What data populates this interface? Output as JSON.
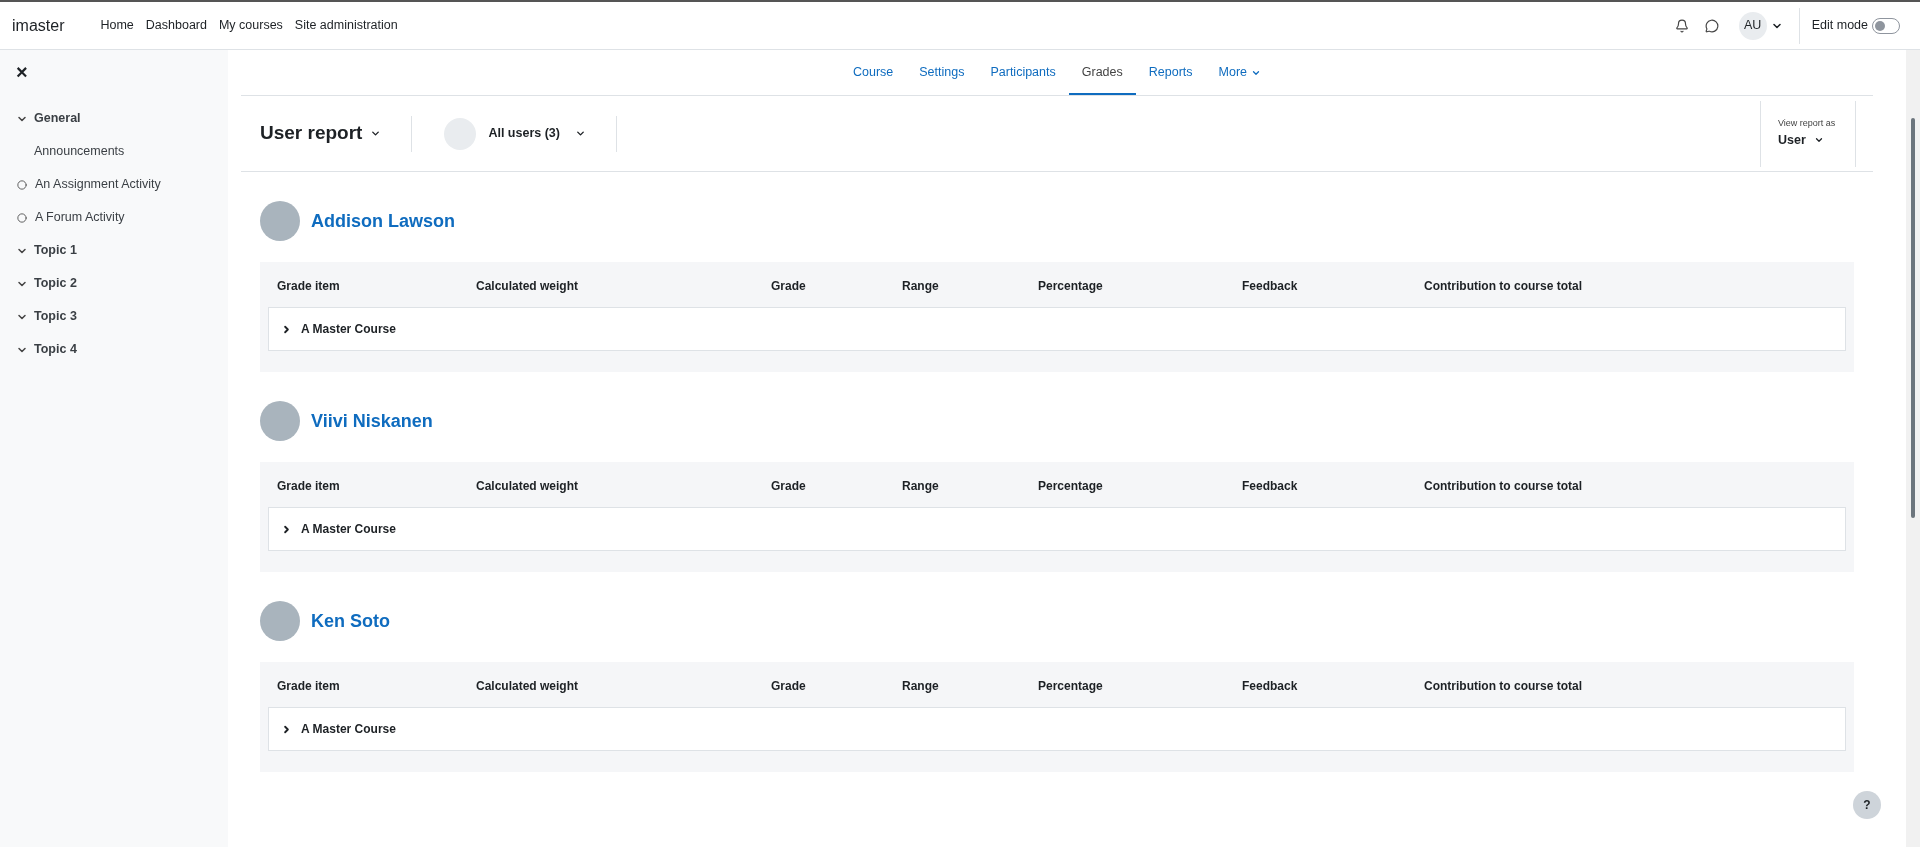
{
  "navbar": {
    "brand": "imaster",
    "links": [
      "Home",
      "Dashboard",
      "My courses",
      "Site administration"
    ],
    "user_initials": "AU",
    "edit_mode": {
      "label": "Edit mode",
      "on": false
    }
  },
  "sidebar": {
    "close": "×",
    "items": [
      {
        "kind": "section",
        "label": "General",
        "expanded": true
      },
      {
        "kind": "page",
        "label": "Announcements"
      },
      {
        "kind": "activity",
        "label": "An Assignment Activity"
      },
      {
        "kind": "activity",
        "label": "A Forum Activity"
      },
      {
        "kind": "section",
        "label": "Topic 1",
        "expanded": true
      },
      {
        "kind": "section",
        "label": "Topic 2",
        "expanded": true
      },
      {
        "kind": "section",
        "label": "Topic 3",
        "expanded": true
      },
      {
        "kind": "section",
        "label": "Topic 4",
        "expanded": true
      }
    ]
  },
  "tabs": [
    {
      "label": "Course",
      "selected": false
    },
    {
      "label": "Settings",
      "selected": false
    },
    {
      "label": "Participants",
      "selected": false
    },
    {
      "label": "Grades",
      "selected": true
    },
    {
      "label": "Reports",
      "selected": false
    },
    {
      "label": "More",
      "selected": false
    }
  ],
  "report_header": {
    "title": "User report",
    "user_filter": "All users (3)",
    "view_as_label": "View report as",
    "view_as": "User"
  },
  "users": [
    {
      "name": "Addison Lawson",
      "columns": [
        "Grade item",
        "Calculated weight",
        "Grade",
        "Range",
        "Percentage",
        "Feedback",
        "Contribution to course total"
      ],
      "rows": [
        {
          "label": "A Master Course",
          "expanded": false
        }
      ]
    },
    {
      "name": "Viivi Niskanen",
      "columns": [
        "Grade item",
        "Calculated weight",
        "Grade",
        "Range",
        "Percentage",
        "Feedback",
        "Contribution to course total"
      ],
      "rows": [
        {
          "label": "A Master Course",
          "expanded": false
        }
      ]
    },
    {
      "name": "Ken Soto",
      "columns": [
        "Grade item",
        "Calculated weight",
        "Grade",
        "Range",
        "Percentage",
        "Feedback",
        "Contribution to course total"
      ],
      "rows": [
        {
          "label": "A Master Course",
          "expanded": false
        }
      ]
    }
  ],
  "help": "?"
}
